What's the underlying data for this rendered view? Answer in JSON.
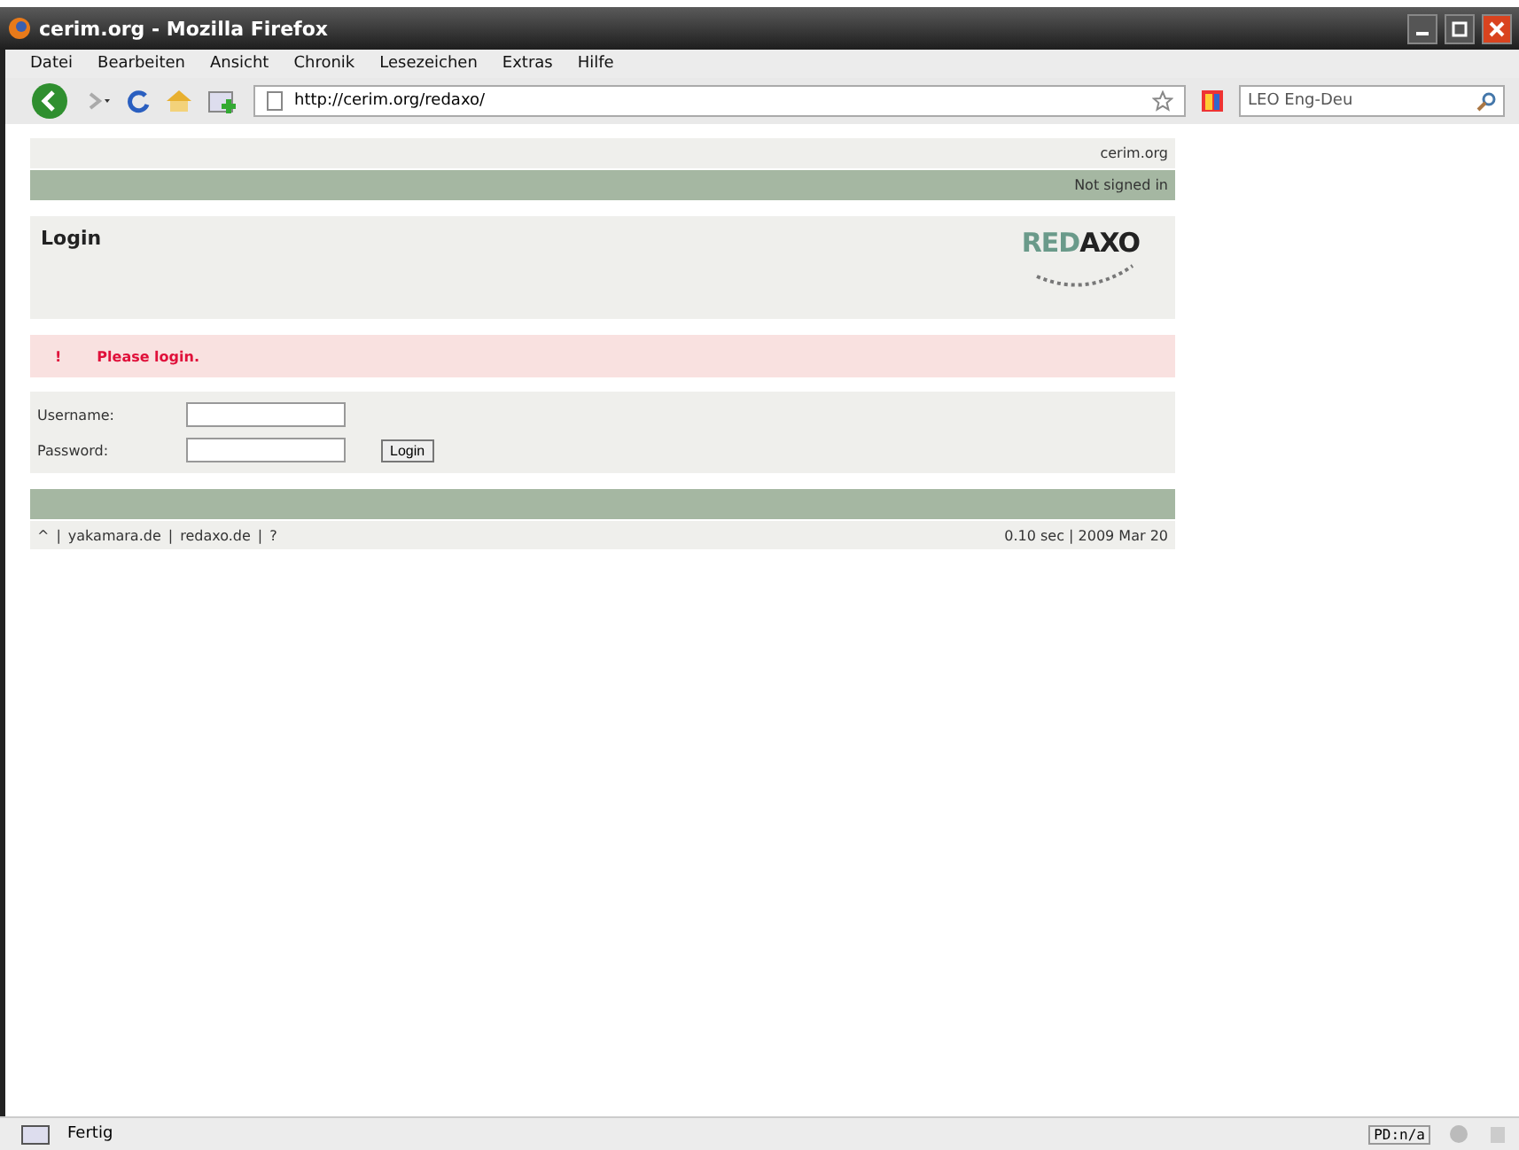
{
  "window": {
    "title": "cerim.org - Mozilla Firefox"
  },
  "menu": [
    "Datei",
    "Bearbeiten",
    "Ansicht",
    "Chronik",
    "Lesezeichen",
    "Extras",
    "Hilfe"
  ],
  "toolbar": {
    "url": "http://cerim.org/redaxo/",
    "search_engine": "LEO Eng-Deu"
  },
  "page": {
    "site": "cerim.org",
    "user_status": "Not signed in",
    "heading": "Login",
    "logo": {
      "part_1": "RED",
      "part_2": "AXO"
    },
    "error": {
      "mark": "!",
      "message": "Please login."
    },
    "fields": [
      {
        "label": "Username:"
      },
      {
        "label": "Password:"
      }
    ],
    "submit": "Login",
    "footer": {
      "links": [
        "^",
        "yakamara.de",
        "redaxo.de",
        "?"
      ],
      "separator": "|",
      "info": "0.10 sec | 2009 Mar 20"
    }
  },
  "status_bar": {
    "text": "Fertig",
    "badge": "PD:n/a"
  }
}
